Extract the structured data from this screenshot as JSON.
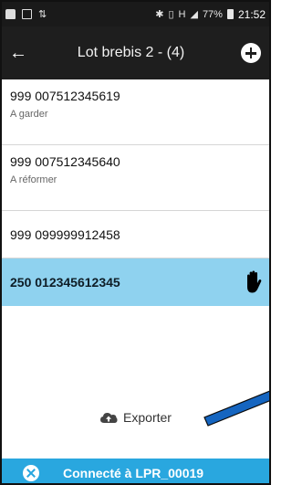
{
  "statusbar": {
    "left_icons": [
      "bag-icon",
      "image-icon",
      "cellular-data-icon"
    ],
    "right_icons": [
      "bluetooth-icon",
      "vibrate-icon",
      "network-h-icon",
      "signal-icon",
      "battery-icon"
    ],
    "network_type": "H",
    "battery": "77%",
    "time": "21:52"
  },
  "appbar": {
    "back_icon": "arrow-left-icon",
    "title": "Lot brebis 2 - (4)",
    "add_icon": "plus-circle-icon"
  },
  "list": {
    "items": [
      {
        "id": "999 007512345619",
        "note": "A garder",
        "selected": false
      },
      {
        "id": "999 007512345640",
        "note": "A réformer",
        "selected": false
      },
      {
        "id": "999 099999912458",
        "note": "",
        "selected": false
      },
      {
        "id": "250 012345612345",
        "note": "",
        "selected": true,
        "icon": "hand-icon"
      }
    ]
  },
  "export": {
    "label": "Exporter",
    "icon": "cloud-upload-icon"
  },
  "bottombar": {
    "status": "Connecté à LPR_00019",
    "icon": "close-circle-icon",
    "color": "#29a7df"
  },
  "colors": {
    "selected_row": "#8fd2ef",
    "appbar": "#1e1e1e",
    "annotation_arrow": "#1565c0"
  }
}
